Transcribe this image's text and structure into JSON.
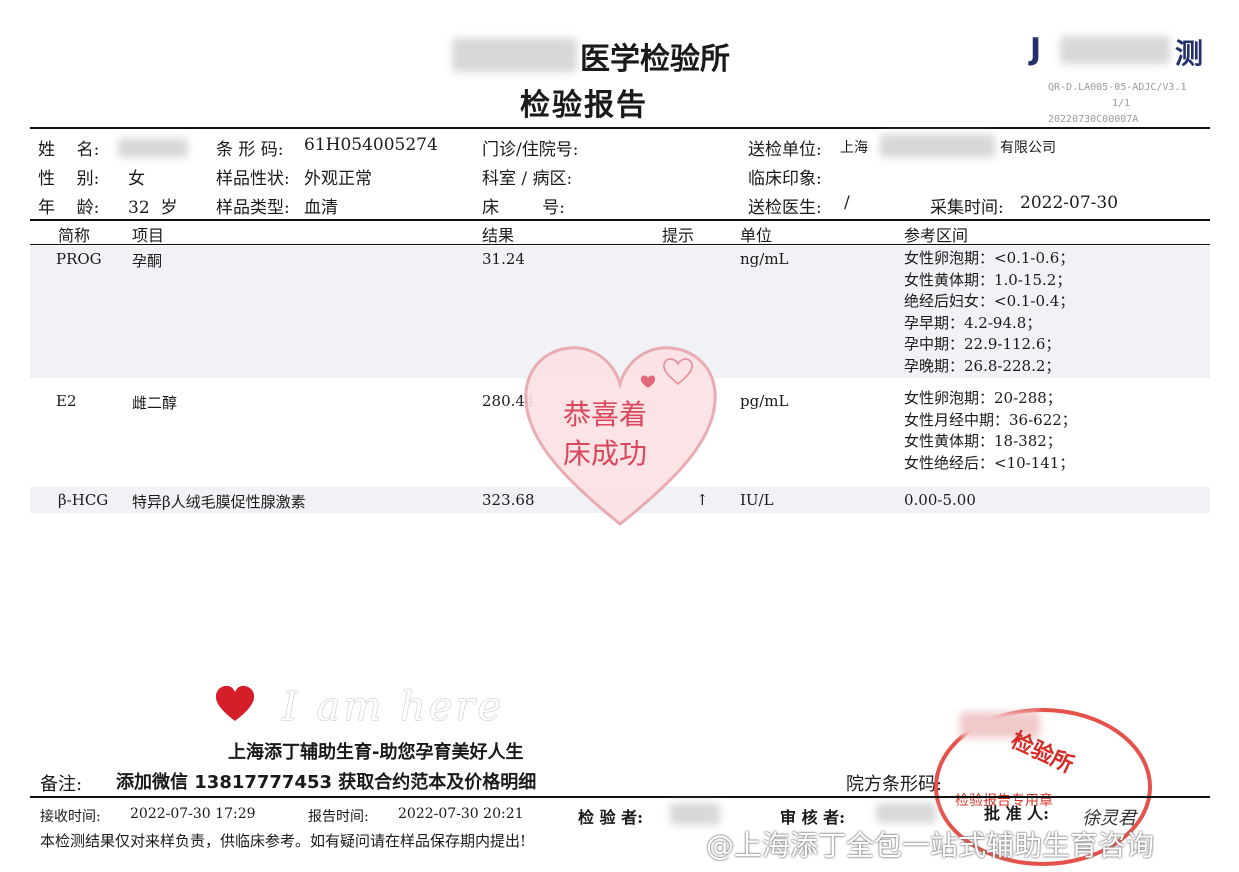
{
  "header": {
    "title_partial": "医学检验所",
    "subtitle": "检验报告",
    "logo_partial": "J",
    "logo_end": "测",
    "doc_code": "QR-D.LA005-05-ADJC/V3.1",
    "page": "1/1",
    "serial": "20220730C00007A"
  },
  "patient": {
    "name_label": "姓    名:",
    "gender_label": "性    别:",
    "gender": "女",
    "age_label": "年    龄:",
    "age": "32  岁",
    "barcode_label": "条 形 码:",
    "barcode": "61H054005274",
    "sample_state_label": "样品性状:",
    "sample_state": "外观正常",
    "sample_type_label": "样品类型:",
    "sample_type": "血清",
    "clinic_label": "门诊/住院号:",
    "dept_label": "科室 / 病区:",
    "bed_label": "床        号:",
    "send_unit_label": "送检单位:",
    "send_unit_start": "上海",
    "send_unit_end": "有限公司",
    "impression_label": "临床印象:",
    "doctor_label": "送检医生:",
    "doctor": "/",
    "collect_time_label": "采集时间:",
    "collect_time": "2022-07-30"
  },
  "columns": {
    "abbr": "简称",
    "item": "项目",
    "result": "结果",
    "hint": "提示",
    "unit": "单位",
    "ref": "参考区间"
  },
  "rows": [
    {
      "abbr": "PROG",
      "item": "孕酮",
      "result": "31.24",
      "hint": "",
      "unit": "ng/mL",
      "ref": "女性卵泡期：<0.1-0.6；\n女性黄体期：1.0-15.2；\n绝经后妇女：<0.1-0.4；\n孕早期：4.2-94.8；\n孕中期：22.9-112.6；\n孕晚期：26.8-228.2；"
    },
    {
      "abbr": "E2",
      "item": "雌二醇",
      "result": "280.44",
      "hint": "",
      "unit": "pg/mL",
      "ref": "女性卵泡期：20-288；\n女性月经中期：36-622；\n女性黄体期：18-382；\n女性绝经后：<10-141；"
    },
    {
      "abbr": "β-HCG",
      "item": "特异β人绒毛膜促性腺激素",
      "result": "323.68",
      "hint": "↑",
      "unit": "IU/L",
      "ref": "0.00-5.00"
    }
  ],
  "sticker": {
    "line1": "恭喜着",
    "line2": "床成功"
  },
  "promo": {
    "script": "I am here",
    "line1": "上海添丁辅助生育-助您孕育美好人生",
    "line2": "添加微信 13817777453 获取合约范本及价格明细"
  },
  "footer": {
    "remark_label": "备注:",
    "hospital_barcode_label": "院方条形码:",
    "receive_label": "接收时间:",
    "receive_time": "2022-07-30 17:29",
    "report_label": "报告时间:",
    "report_time": "2022-07-30 20:21",
    "tester_label": "检 验 者:",
    "reviewer_label": "审 核 者:",
    "approver_label": "批 准 人:",
    "signature": "徐灵君",
    "disclaimer": "本检测结果仅对来样负责，供临床参考。如有疑问请在样品保存期内提出!"
  },
  "stamp": {
    "text": "检验所",
    "inner": "检验报告专用章"
  },
  "watermark": "@上海添丁全包一站式辅助生育咨询"
}
